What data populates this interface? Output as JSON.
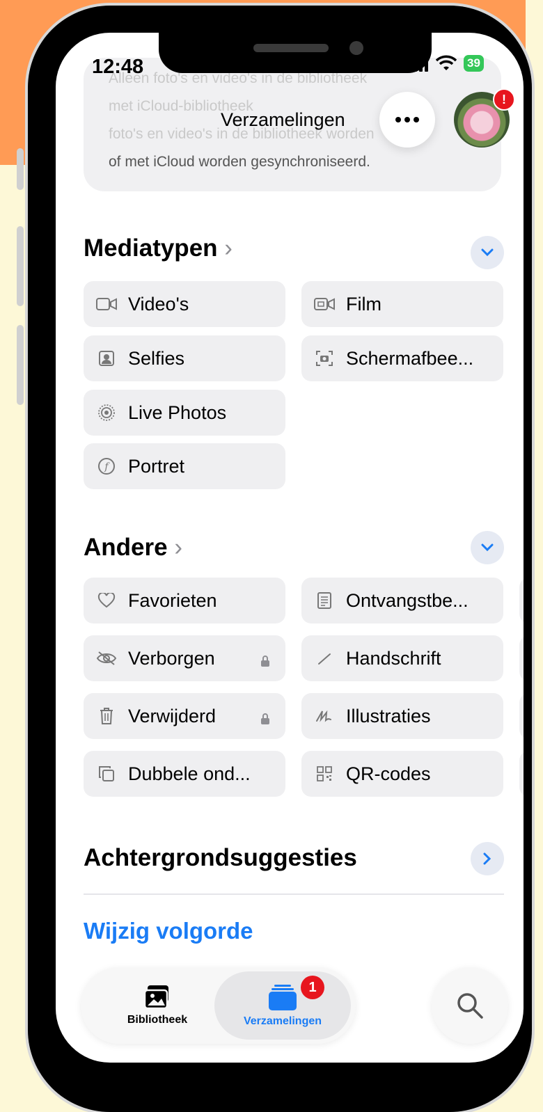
{
  "status": {
    "time": "12:48",
    "battery": "39"
  },
  "faded_card": {
    "line1": "Alleen foto's en video's in de bibliotheek",
    "line2": "met iCloud-bibliotheek",
    "line3": "foto's en video's in de bibliotheek worden",
    "line4": "of met iCloud worden gesynchroniseerd."
  },
  "nav": {
    "title": "Verzamelingen",
    "avatar_badge": "!"
  },
  "mediatypen": {
    "title": "Mediatypen",
    "items": [
      "Video's",
      "Film",
      "Selfies",
      "Schermafbee...",
      "Live Photos",
      "Portret"
    ]
  },
  "andere": {
    "title": "Andere",
    "items": [
      "Favorieten",
      "Ontvangstbe...",
      "Verborgen",
      "Handschrift",
      "Verwijderd",
      "Illustraties",
      "Dubbele ond...",
      "QR-codes"
    ]
  },
  "achtergrond": {
    "title": "Achtergrondsuggesties"
  },
  "edit_link": "Wijzig volgorde",
  "tabs": {
    "library": "Bibliotheek",
    "collections": "Verzamelingen",
    "collections_badge": "1"
  },
  "colors": {
    "accent": "#1a7cf5",
    "badge": "#e7161e"
  }
}
